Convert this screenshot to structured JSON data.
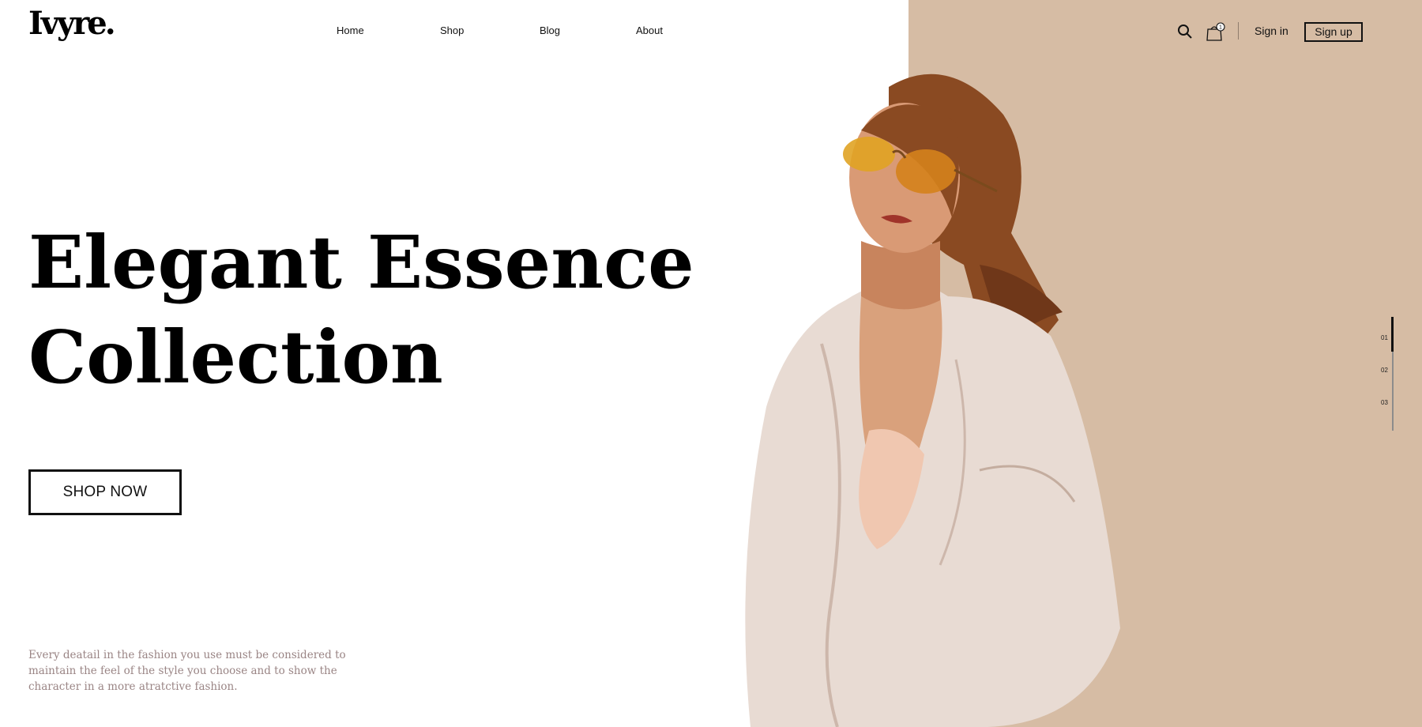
{
  "brand": {
    "logo": "Ivyre."
  },
  "nav": {
    "items": [
      "Home",
      "Shop",
      "Blog",
      "About"
    ]
  },
  "header": {
    "search_icon": "search-icon",
    "cart_icon": "shopping-bag-icon",
    "cart_count": "1",
    "signin_label": "Sign in",
    "signup_label": "Sign up"
  },
  "hero": {
    "title_line1": "Elegant Essence",
    "title_line2": "Collection",
    "cta_label": "SHOP NOW",
    "description": "Every deatail in the fashion you use must be considered to maintain the feel of the style you choose and to show the character in a more atratctive fashion."
  },
  "slides": {
    "labels": [
      "01",
      "02",
      "03"
    ],
    "active_index": 0
  },
  "colors": {
    "panel": "#d6bca4",
    "text": "#111111",
    "muted_text": "#9a8585"
  }
}
